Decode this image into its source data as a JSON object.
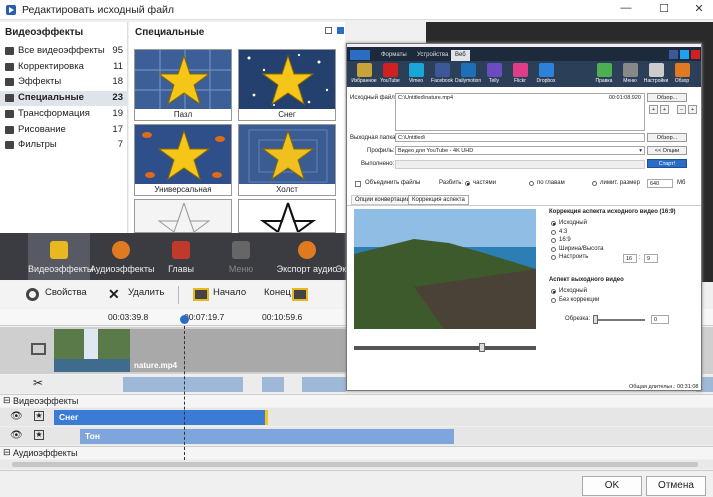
{
  "window": {
    "title": "Редактировать исходный файл"
  },
  "categories": {
    "heading": "Видеоэффекты",
    "items": [
      {
        "label": "Все видеоэффекты",
        "count": "95"
      },
      {
        "label": "Корректировка",
        "count": "11"
      },
      {
        "label": "Эффекты",
        "count": "18"
      },
      {
        "label": "Специальные",
        "count": "23"
      },
      {
        "label": "Трансформация",
        "count": "19"
      },
      {
        "label": "Рисование",
        "count": "17"
      },
      {
        "label": "Фильтры",
        "count": "7"
      }
    ],
    "selected_index": 3
  },
  "gallery": {
    "heading": "Специальные",
    "effects": [
      "Пазл",
      "Снег",
      "Универсальная система...",
      "Холст",
      "",
      ""
    ]
  },
  "tabs": [
    {
      "label": "Видеоэффекты",
      "icon": "star-icon"
    },
    {
      "label": "Аудиоэффекты",
      "icon": "speaker-icon"
    },
    {
      "label": "Главы",
      "icon": "film-icon"
    },
    {
      "label": "Меню",
      "icon": "lock-icon"
    },
    {
      "label": "Экспорт аудио",
      "icon": "speaker-export-icon"
    },
    {
      "label": "Эк",
      "icon": ""
    }
  ],
  "actions": {
    "properties": "Свойства",
    "delete": "Удалить",
    "start": "Начало",
    "end": "Конец"
  },
  "timeline": {
    "times": [
      "00:03:39.8",
      "00:07:19.7",
      "00:10:59.6"
    ],
    "clip_name": "nature.mp4",
    "video_effects_label": "Видеоэффекты",
    "audio_effects_label": "Аудиоэффекты",
    "effect_clips": [
      "Снег",
      "Тон"
    ]
  },
  "footer": {
    "ok": "OK",
    "cancel": "Отмена"
  },
  "avs": {
    "title": "AVS Video Converter",
    "tabs": [
      "Форматы",
      "Устройства",
      "Веб"
    ],
    "icons": [
      "Избранное",
      "YouTube",
      "Vimeo",
      "Facebook",
      "Dailymotion",
      "Telly",
      "Flickr",
      "Dropbox",
      "Правка",
      "Меню",
      "Настройки",
      "Обзор"
    ],
    "icon_colors": [
      "#c8a33a",
      "#d02020",
      "#1aa7d8",
      "#3b5998",
      "#1d6fb8",
      "#6a4cc0",
      "#e03c8a",
      "#2a83d8",
      "#4caf50",
      "#888888",
      "#cccccc",
      "#e07a20"
    ],
    "source_label": "Исходный файл:",
    "source_path": "C:\\Untitled\\nature.mp4",
    "source_time": "00:01:08.920",
    "browse": "Обзор...",
    "output_label": "Выходная папка:",
    "output_path": "C:\\Untitled\\",
    "profile_label": "Профиль:",
    "profile_value": "Видео для YouTube - 4K UHD",
    "options_btn": "<< Опции",
    "done_label": "Выполнено:",
    "start_btn": "Старт!",
    "join_label": "Объединить файлы",
    "split_label": "Разбить:",
    "split_opts": [
      "частями",
      "по главам",
      "лимит. размер"
    ],
    "size_value": "640",
    "size_unit": "Мб",
    "subtabs": [
      "Опции конвертации",
      "Коррекция аспекта"
    ],
    "aspect_src_heading": "Коррекция аспекта исходного видео (16:9)",
    "aspect_src_opts": [
      "Исходный",
      "4:3",
      "16:9",
      "Ширина/Высота",
      "Настроить"
    ],
    "custom_w": "16",
    "custom_h": "9",
    "aspect_out_heading": "Аспект выходного видео",
    "aspect_out_opts": [
      "Исходный",
      "Без коррекции"
    ],
    "crop_label": "Обрезка:",
    "crop_value": "0",
    "total_duration": "Общая длительн.: 00:31:08"
  }
}
